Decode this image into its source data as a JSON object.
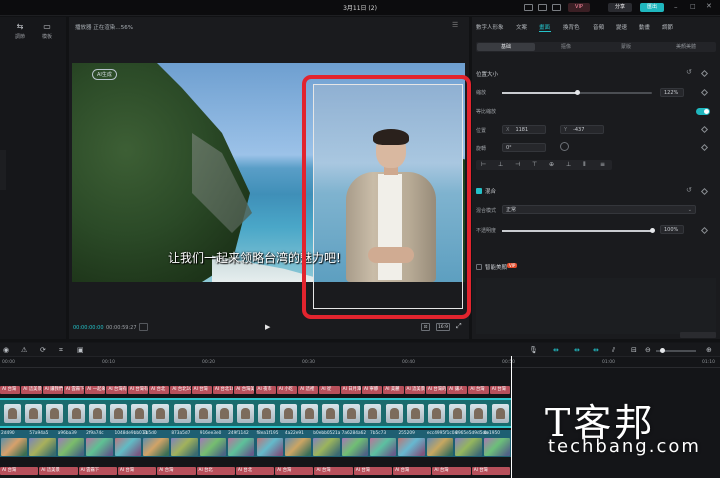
{
  "window": {
    "title": "3月11日 (2)"
  },
  "titlebar": {
    "pill_vip": "VIP",
    "pill_share": "分享",
    "pill_export": "匯出"
  },
  "left_panel": {
    "tools": [
      {
        "label": "調節"
      },
      {
        "label": "模板"
      }
    ]
  },
  "player": {
    "title": "播放器 正在渲染…56%",
    "watermark": "AI生成",
    "subtitle": "让我们一起来领略台湾的魅力吧!",
    "timecode_current": "00:00:00:00",
    "timecode_total": "00:00:59:27",
    "ratio_label": "16:9"
  },
  "right_panel": {
    "tabs": [
      "數字人形象",
      "文案",
      "畫面",
      "換背色",
      "音頻",
      "變速",
      "動畫",
      "調節"
    ],
    "active_tab": "畫面",
    "subtabs": [
      "基础",
      "摳像",
      "蒙版",
      "美顏美體"
    ],
    "active_subtab": "基础",
    "position_size_label": "位置大小",
    "scale_label": "縮放",
    "scale_value": "122%",
    "scale_fraction": 0.5,
    "uniform_scale_label": "等比縮放",
    "position_label": "位置",
    "pos_x_label": "X",
    "pos_x": "1181",
    "pos_y_label": "Y",
    "pos_y": "-437",
    "rotate_label": "旋轉",
    "rotate_value": "0°",
    "blend_label": "混合",
    "blend_mode_label": "混合模式",
    "blend_mode_value": "正常",
    "opacity_label": "不透明度",
    "opacity_value": "100%",
    "opacity_fraction": 1.0,
    "smart_beauty_label": "智能美顏",
    "vip_badge": "VIP"
  },
  "timeline": {
    "ruler_ticks": [
      "00:00",
      "00:10",
      "00:20",
      "00:30",
      "00:40",
      "00:50",
      "01:00",
      "01:10"
    ],
    "top_clips": [
      "AI 台灣",
      "AI 這美景",
      "AI 讓我們",
      "AI 雲霧下",
      "AI 一起來",
      "AI 台灣有",
      "AI 台灣有著豐富的",
      "AI 台北",
      "AI 台北101",
      "AI 台灣",
      "AI 台北101大樓",
      "AI 台灣美食",
      "AI 夜市",
      "AI 小吃",
      "AI 這裡",
      "AI 從",
      "AI 日月潭",
      "AI 寧靜",
      "AI 美麗",
      "AI 這美景",
      "AI 台灣的魅力",
      "AI 讓人",
      "AI 台灣",
      "AI 台灣"
    ],
    "thumb_labels": [
      "2d490",
      "57a94a5",
      "a96ba39",
      "2f9a74c",
      "1048de9bb073",
      "2b5d0",
      "873a5d7",
      "916ee3e0",
      "249f1142",
      "f8ea1f195",
      "4a22e91",
      "b0ebb0521a",
      "7a6284a62",
      "7b5c73",
      "255209",
      "ecc4995f1c04",
      "8965e5d9d5da",
      "4e1950"
    ],
    "bottom_clips": [
      "AI 台灣",
      "AI 這美景",
      "AI 雲霧下",
      "AI 台灣",
      "AI 台灣",
      "AI 台北",
      "AI 台北",
      "AI 台灣",
      "AI 台灣",
      "AI 台灣",
      "AI 台灣",
      "AI 台灣",
      "AI 台灣"
    ]
  },
  "logo": {
    "main": "T客邦",
    "sub": "techbang.com"
  },
  "colors": {
    "accent": "#24c2c9",
    "highlight_box": "#e2242e",
    "clip_label": "#b7505b"
  }
}
